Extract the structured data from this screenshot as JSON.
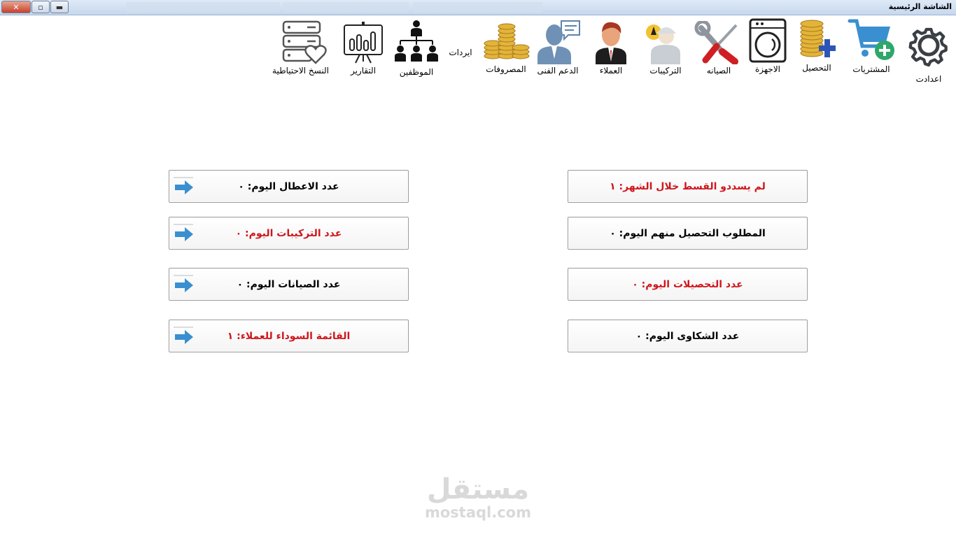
{
  "window": {
    "title": "الشاشة الرئيسية"
  },
  "toolbar": [
    {
      "key": "settings",
      "label": "اعدادت",
      "icon": "gear-icon"
    },
    {
      "key": "purchases",
      "label": "المشتريات",
      "icon": "cart-add-icon"
    },
    {
      "key": "collection",
      "label": "التحصيل",
      "icon": "coins-plus-icon"
    },
    {
      "key": "devices",
      "label": "الاجهزة",
      "icon": "washing-machine-icon"
    },
    {
      "key": "maintenance",
      "label": "الصيانه",
      "icon": "wrench-screwdriver-icon"
    },
    {
      "key": "installations",
      "label": "التركيبات",
      "icon": "engineer-icon"
    },
    {
      "key": "clients",
      "label": "العملاء",
      "icon": "client-person-icon"
    },
    {
      "key": "support",
      "label": "الدعم الفنى",
      "icon": "support-chat-icon"
    },
    {
      "key": "expenses",
      "label": "المصروفات",
      "icon": "coin-stacks-icon"
    },
    {
      "key": "revenues",
      "label": "ايردات",
      "icon": ""
    },
    {
      "key": "employees",
      "label": "الموظفين",
      "icon": "org-chart-icon"
    },
    {
      "key": "reports",
      "label": "التقارير",
      "icon": "presentation-chart-icon"
    },
    {
      "key": "backups",
      "label": "النسخ الاحتياطية",
      "icon": "server-heart-icon"
    }
  ],
  "stats": {
    "unpaid_installment_month": "لم يسددو القسط خلال الشهر: ١",
    "faults_today": "عدد الاعطال اليوم: ٠",
    "to_collect_today": "المطلوب التحصيل منهم اليوم: ٠",
    "installations_today": "عدد التركيبات اليوم: ٠",
    "collections_today": "عدد التحصيلات اليوم: ٠",
    "maintenance_today": "عدد الصيانات اليوم: ٠",
    "complaints_today": "عدد الشكاوى اليوم: ٠",
    "blacklist_clients": "القائمة السوداء للعملاء: ١"
  },
  "watermark": {
    "arabic": "مستقل",
    "latin": "mostaql.com"
  },
  "colors": {
    "alert_red": "#d0161c",
    "arrow_blue": "#3a8fd0"
  }
}
